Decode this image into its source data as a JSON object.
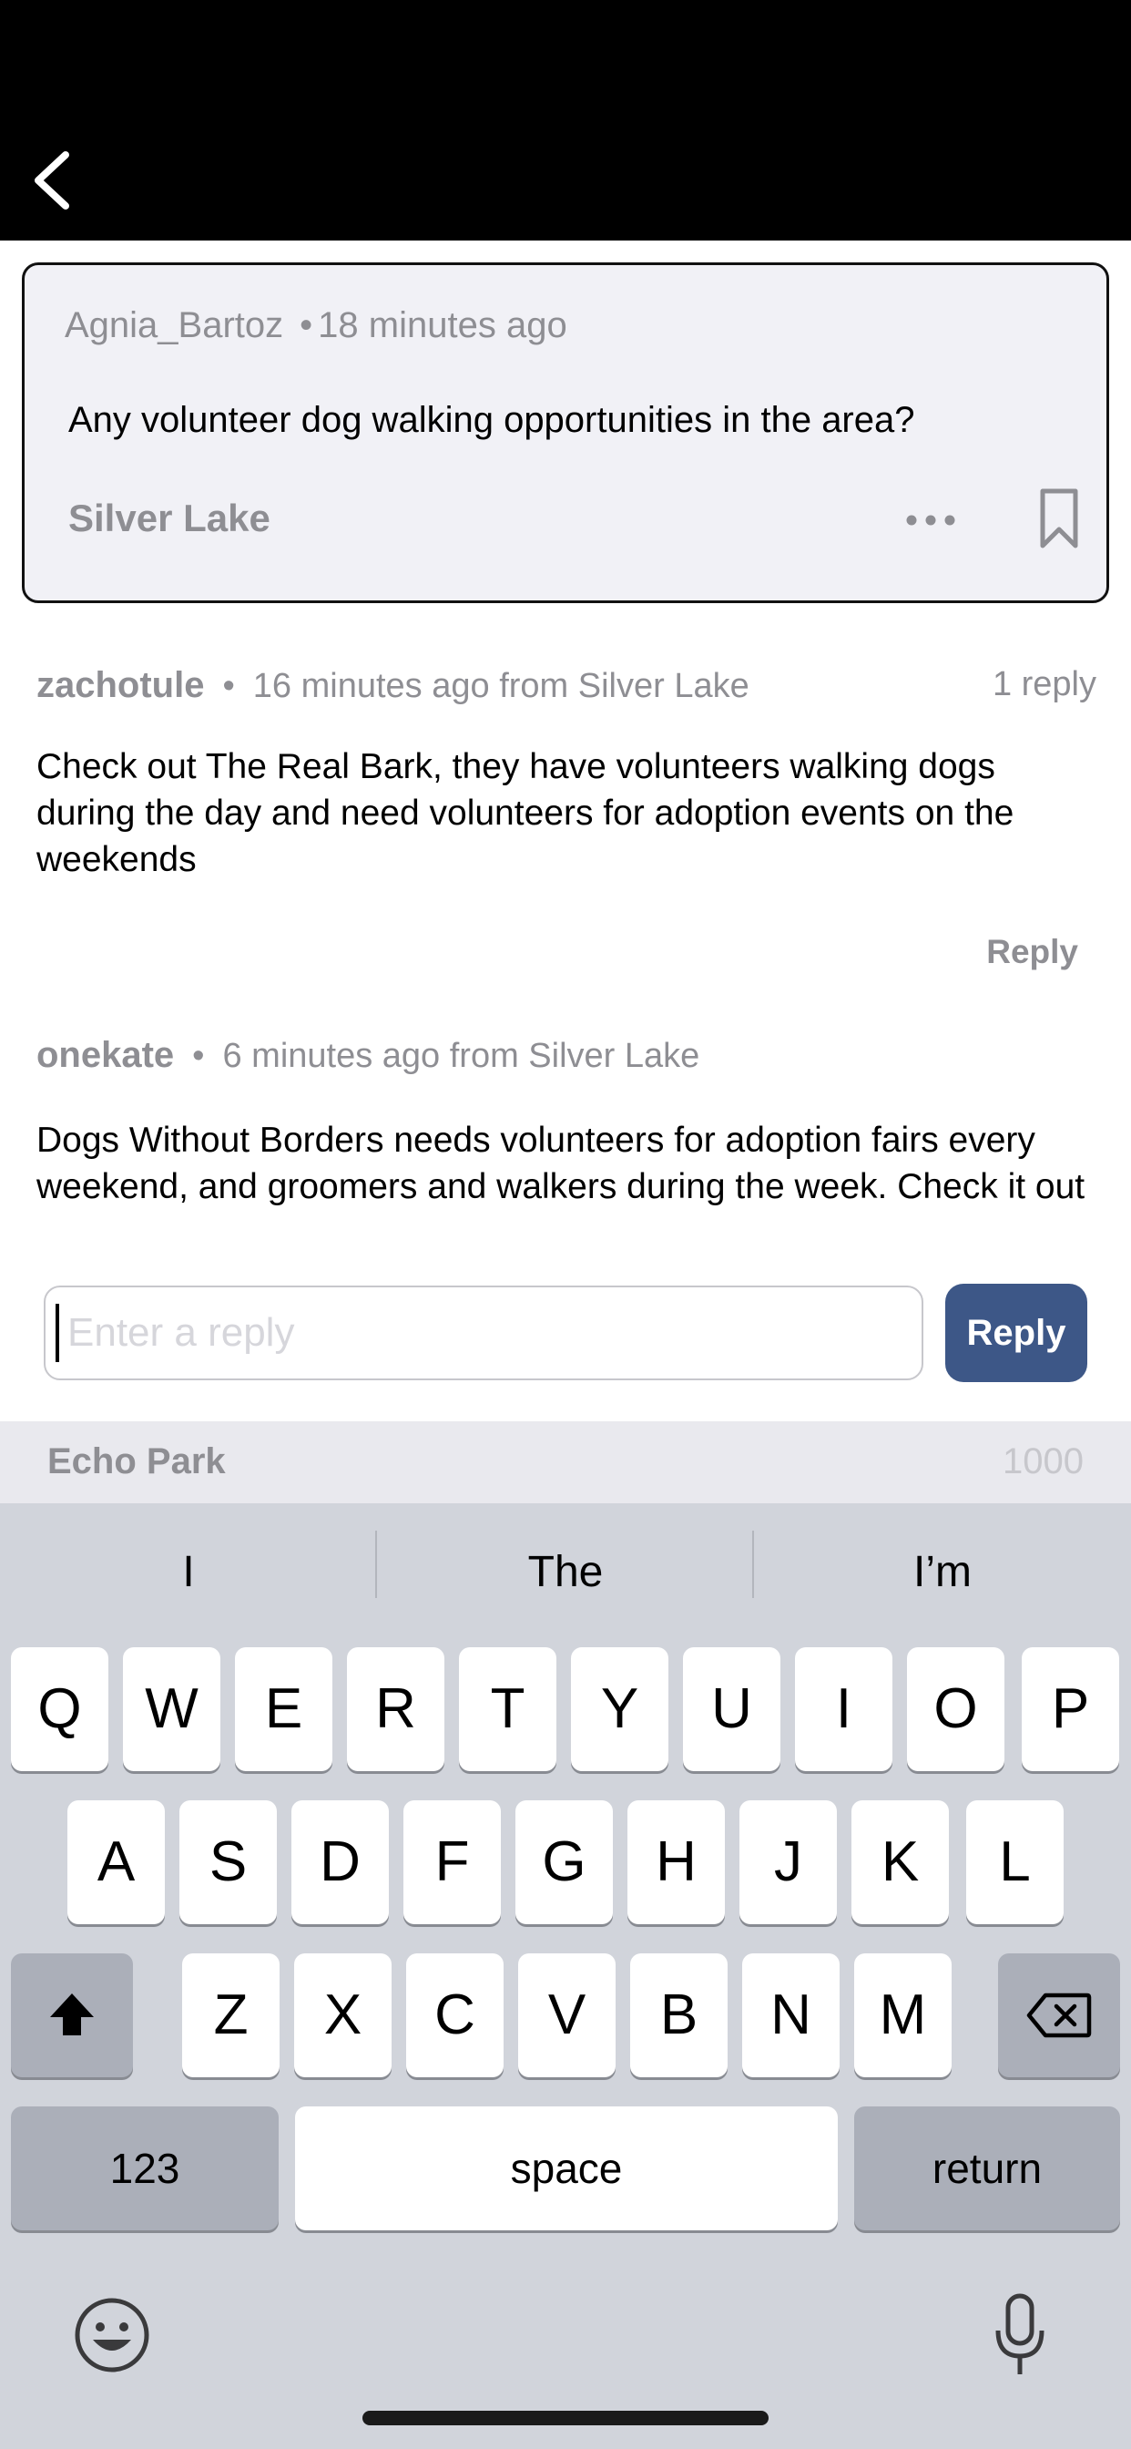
{
  "post": {
    "author": "Agnia_Bartoz",
    "time": "18 minutes ago",
    "body": "Any volunteer dog walking opportunities in the area?",
    "location": "Silver Lake"
  },
  "comments": [
    {
      "user": "zachotule",
      "meta": "16 minutes ago from Silver Lake",
      "reply_count": "1 reply",
      "text": "Check out The Real Bark, they have volunteers walking dogs during the day and need volunteers for adoption events on the weekends",
      "reply_label": "Reply"
    },
    {
      "user": "onekate",
      "meta": "6 minutes ago from Silver Lake",
      "text": "Dogs Without Borders needs volunteers for adoption fairs every weekend, and groomers and walkers during the week. Check it out"
    }
  ],
  "composer": {
    "placeholder": "Enter a reply",
    "button_label": "Reply",
    "location": "Echo Park",
    "char_limit": "1000"
  },
  "keyboard": {
    "suggestions": [
      "I",
      "The",
      "I’m"
    ],
    "row1": [
      "Q",
      "W",
      "E",
      "R",
      "T",
      "Y",
      "U",
      "I",
      "O",
      "P"
    ],
    "row2": [
      "A",
      "S",
      "D",
      "F",
      "G",
      "H",
      "J",
      "K",
      "L"
    ],
    "row3": [
      "Z",
      "X",
      "C",
      "V",
      "B",
      "N",
      "M"
    ],
    "numbers_label": "123",
    "space_label": "space",
    "return_label": "return"
  },
  "icons": {
    "back": "chevron-left-icon",
    "more": "ellipsis-icon",
    "bookmark": "bookmark-icon",
    "shift": "shift-icon",
    "delete": "backspace-icon",
    "emoji": "emoji-icon",
    "mic": "microphone-icon"
  },
  "colors": {
    "accent": "#3d5787",
    "muted_text": "#8e8e93",
    "card_bg": "#f1f1f6",
    "keyboard_bg": "#d1d4db"
  }
}
